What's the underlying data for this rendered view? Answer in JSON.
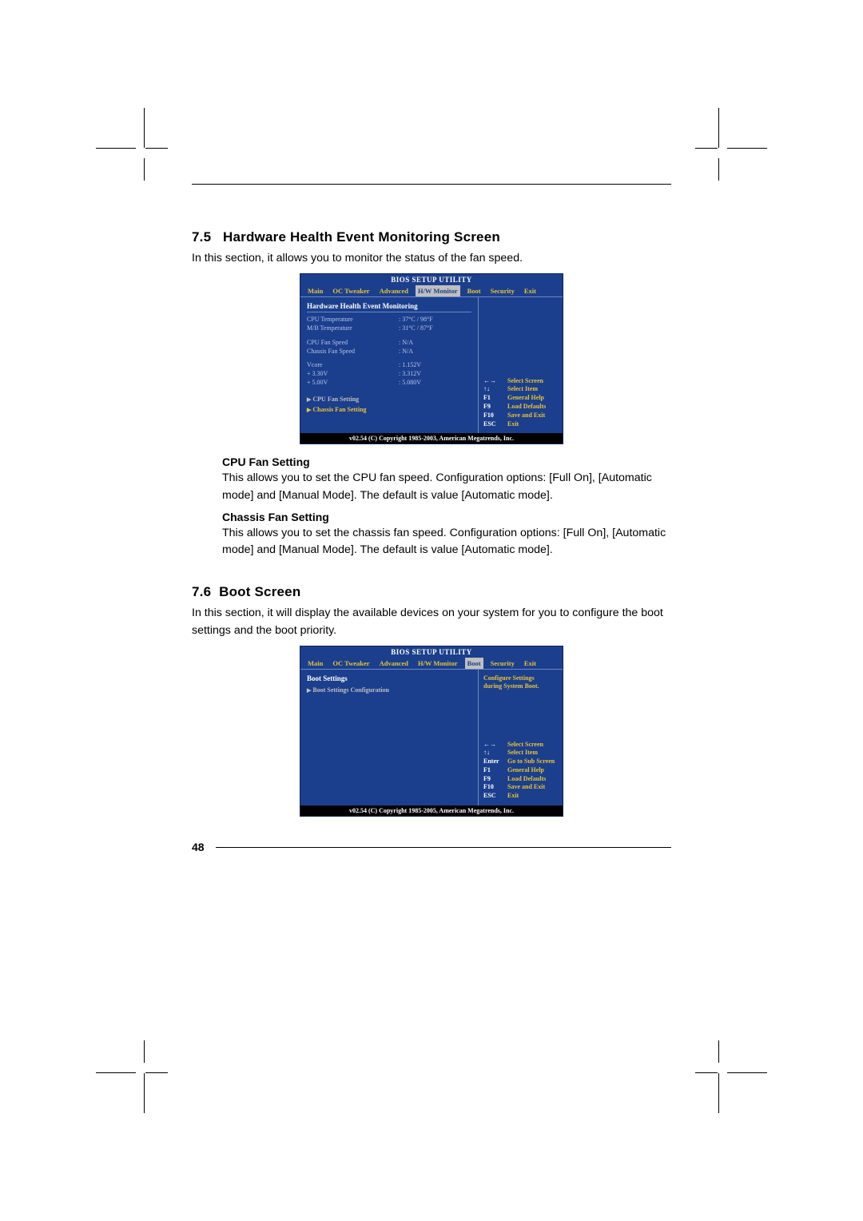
{
  "page_number": "48",
  "section_75": {
    "number": "7.5",
    "title": "Hardware Health Event Monitoring Screen",
    "intro": "In this section, it allows you to monitor the status of the fan speed.",
    "cpu_fan_heading": "CPU Fan Setting",
    "cpu_fan_body": "This allows you to set the CPU fan speed. Configuration options: [Full On], [Automatic mode] and [Manual Mode]. The default is value [Automatic mode].",
    "chassis_fan_heading": "Chassis Fan Setting",
    "chassis_fan_body": "This allows you to set the chassis fan speed. Configuration options: [Full On], [Automatic mode] and [Manual Mode]. The default is value [Automatic mode]."
  },
  "section_76": {
    "number": "7.6",
    "title": "Boot Screen",
    "intro": "In this section, it will display the available devices on your system for you to configure the boot settings and the boot priority."
  },
  "bios1": {
    "title": "BIOS SETUP UTILITY",
    "tabs": {
      "main": "Main",
      "oc": "OC Tweaker",
      "adv": "Advanced",
      "hw": "H/W Monitor",
      "boot": "Boot",
      "sec": "Security",
      "exit": "Exit"
    },
    "panel_title": "Hardware Health Event Monitoring",
    "rows": {
      "cpu_temp_l": "CPU Temperature",
      "cpu_temp_v": ": 37°C / 98°F",
      "mb_temp_l": "M/B Temperature",
      "mb_temp_v": ": 31°C / 87°F",
      "cpu_fan_l": "CPU Fan Speed",
      "cpu_fan_v": ": N/A",
      "ch_fan_l": "Chassis Fan Speed",
      "ch_fan_v": ": N/A",
      "vcore_l": "Vcore",
      "vcore_v": ": 1.152V",
      "v33_l": "+  3.30V",
      "v33_v": ": 3.312V",
      "v5_l": "+  5.00V",
      "v5_v": ": 5.080V"
    },
    "links": {
      "cpu": "CPU Fan Setting",
      "chassis": "Chassis Fan Setting"
    },
    "help": {
      "k1": "←→",
      "d1": "Select Screen",
      "k2": "↑↓",
      "d2": "Select Item",
      "k3": "F1",
      "d3": "General Help",
      "k4": "F9",
      "d4": "Load Defaults",
      "k5": "F10",
      "d5": "Save and Exit",
      "k6": "ESC",
      "d6": "Exit"
    },
    "footer": "v02.54 (C) Copyright 1985-2003, American Megatrends, Inc."
  },
  "bios2": {
    "title": "BIOS SETUP UTILITY",
    "tabs": {
      "main": "Main",
      "oc": "OC Tweaker",
      "adv": "Advanced",
      "hw": "H/W Monitor",
      "boot": "Boot",
      "sec": "Security",
      "exit": "Exit"
    },
    "panel_title": "Boot Settings",
    "links": {
      "cfg": "Boot Settings Configuration"
    },
    "help_top": "Configure Settings\nduring System Boot.",
    "help": {
      "k1": "←→",
      "d1": "Select Screen",
      "k2": "↑↓",
      "d2": "Select Item",
      "k3": "Enter",
      "d3": "Go to Sub Screen",
      "k4": "F1",
      "d4": "General Help",
      "k5": "F9",
      "d5": "Load Defaults",
      "k6": "F10",
      "d6": "Save and Exit",
      "k7": "ESC",
      "d7": "Exit"
    },
    "footer": "v02.54 (C) Copyright 1985-2005, American Megatrends, Inc."
  }
}
